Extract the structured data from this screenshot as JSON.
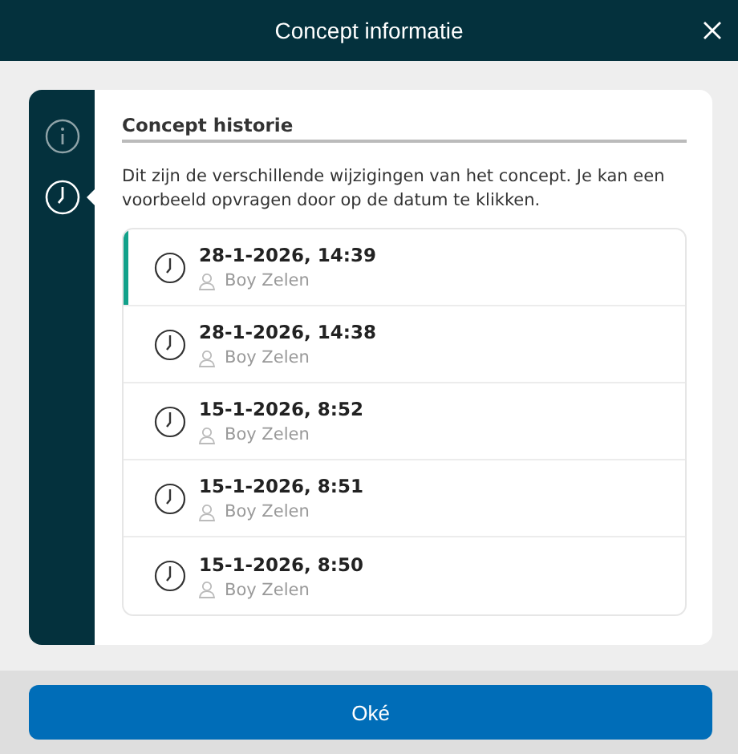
{
  "window": {
    "title": "Concept informatie"
  },
  "sidebar": {
    "items": [
      {
        "kind": "info",
        "selected": false
      },
      {
        "kind": "history",
        "selected": true
      }
    ]
  },
  "section": {
    "title": "Concept historie",
    "description": "Dit zijn de verschillende wijzigingen van het concept. Je kan een voorbeeld opvragen door op de datum te klikken."
  },
  "versions": [
    {
      "date": "28-1-2026, 14:39",
      "author": "Boy Zelen",
      "selected": true
    },
    {
      "date": "28-1-2026, 14:38",
      "author": "Boy Zelen",
      "selected": false
    },
    {
      "date": "15-1-2026, 8:52",
      "author": "Boy Zelen",
      "selected": false
    },
    {
      "date": "15-1-2026, 8:51",
      "author": "Boy Zelen",
      "selected": false
    },
    {
      "date": "15-1-2026, 8:50",
      "author": "Boy Zelen",
      "selected": false
    }
  ],
  "buttons": [
    {
      "label": "Oké"
    }
  ]
}
